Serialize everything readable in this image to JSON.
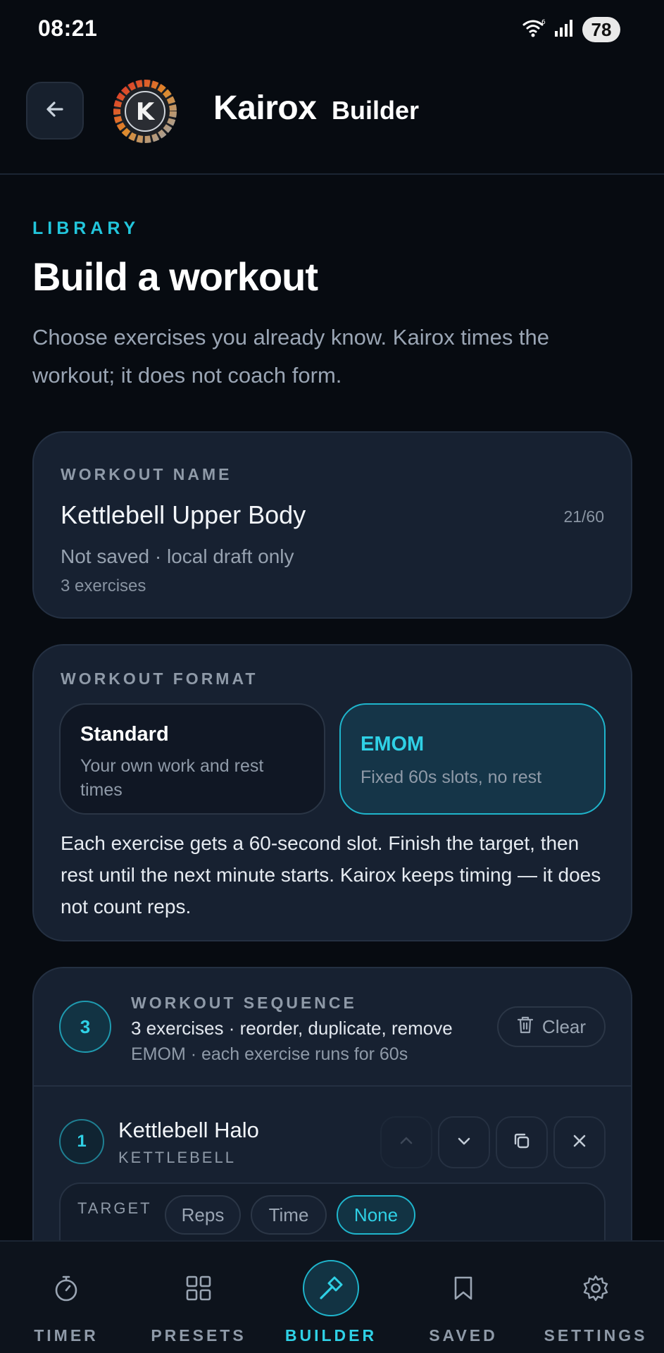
{
  "status_bar": {
    "time": "08:21",
    "battery": "78",
    "wifi_label": "6"
  },
  "header": {
    "brand": "Kairox",
    "subtitle": "Builder",
    "logo_letter": "K"
  },
  "intro": {
    "eyebrow": "LIBRARY",
    "title": "Build a workout",
    "description": "Choose exercises you already know. Kairox times the workout; it does not coach form."
  },
  "workout_name_card": {
    "label": "WORKOUT NAME",
    "name": "Kettlebell Upper Body",
    "char_count": "21/60",
    "save_status": "Not saved · local draft only",
    "exercise_count": "3 exercises"
  },
  "format_card": {
    "label": "WORKOUT FORMAT",
    "options": [
      {
        "title": "Standard",
        "description": "Your own work and rest times",
        "selected": false
      },
      {
        "title": "EMOM",
        "description": "Fixed 60s slots, no rest",
        "selected": true
      }
    ],
    "description": "Each exercise gets a 60-second slot. Finish the target, then rest until the next minute starts. Kairox keeps timing — it does not count reps."
  },
  "sequence_card": {
    "count": "3",
    "label": "WORKOUT SEQUENCE",
    "summary": "3 exercises · reorder, duplicate, remove",
    "mode": "EMOM · each exercise runs for 60s",
    "clear_label": "Clear",
    "exercises": [
      {
        "number": "1",
        "name": "Kettlebell Halo",
        "category": "KETTLEBELL",
        "target_label": "TARGET",
        "target_options": [
          "Reps",
          "Time",
          "None"
        ],
        "target_selected": "None"
      }
    ]
  },
  "bottom_nav": {
    "items": [
      {
        "label": "TIMER",
        "icon": "stopwatch-icon",
        "active": false
      },
      {
        "label": "PRESETS",
        "icon": "grid-icon",
        "active": false
      },
      {
        "label": "BUILDER",
        "icon": "hammer-icon",
        "active": true
      },
      {
        "label": "SAVED",
        "icon": "bookmark-icon",
        "active": false
      },
      {
        "label": "SETTINGS",
        "icon": "gear-icon",
        "active": false
      }
    ]
  },
  "colors": {
    "accent": "#22c6dc",
    "background": "#070b11",
    "card": "#172131"
  }
}
